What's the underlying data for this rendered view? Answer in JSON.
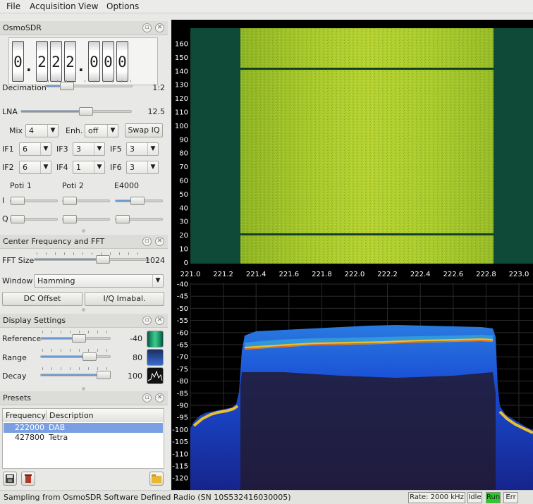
{
  "menu": [
    "File",
    "Acquisition",
    "View",
    "Options"
  ],
  "osmo": {
    "title": "OsmoSDR",
    "freq_digits": [
      "0",
      ".",
      "2",
      "2",
      "2",
      ".",
      "0",
      "0",
      "0"
    ],
    "decimation": {
      "label": "Decimation",
      "value": "1:2",
      "level": 0.25
    },
    "lna": {
      "label": "LNA",
      "value": "12.5",
      "level": 0.59
    },
    "mix": {
      "label": "Mix",
      "value": "4"
    },
    "enh": {
      "label": "Enh.",
      "value": "off"
    },
    "swap_iq": "Swap IQ",
    "if_stages": [
      {
        "label": "IF1",
        "value": "6"
      },
      {
        "label": "IF3",
        "value": "3"
      },
      {
        "label": "IF5",
        "value": "3"
      },
      {
        "label": "IF2",
        "value": "6"
      },
      {
        "label": "IF4",
        "value": "1"
      },
      {
        "label": "IF6",
        "value": "3"
      }
    ],
    "poti_labels": [
      "Poti 1",
      "Poti 2",
      "E4000"
    ],
    "row_i": "I",
    "row_q": "Q"
  },
  "center": {
    "title": "Center Frequency and FFT",
    "fft_size": {
      "label": "FFT Size",
      "value": "1024",
      "level": 0.6
    },
    "window": {
      "label": "Window",
      "value": "Hamming"
    },
    "dc_offset": "DC Offset",
    "iq_imbal": "I/Q Imabal."
  },
  "display": {
    "title": "Display Settings",
    "reference": {
      "label": "Reference",
      "value": "-40",
      "level": 0.55
    },
    "range": {
      "label": "Range",
      "value": "80",
      "level": 0.7
    },
    "decay": {
      "label": "Decay",
      "value": "100",
      "level": 0.98
    }
  },
  "presets": {
    "title": "Presets",
    "col_freq": "Frequency",
    "col_desc": "Description",
    "rows": [
      {
        "freq": "222000",
        "desc": "DAB",
        "selected": true
      },
      {
        "freq": "427800",
        "desc": "Tetra",
        "selected": false
      }
    ]
  },
  "waterfall": {
    "y_ticks": [
      "160",
      "150",
      "140",
      "130",
      "120",
      "110",
      "100",
      "90",
      "80",
      "70",
      "60",
      "50",
      "40",
      "30",
      "20",
      "10",
      "0"
    ],
    "x_ticks": [
      "221.0",
      "221.2",
      "221.4",
      "221.6",
      "221.8",
      "222.0",
      "222.2",
      "222.4",
      "222.6",
      "222.8",
      "223.0"
    ]
  },
  "spectrum": {
    "y_ticks": [
      "-40",
      "-45",
      "-50",
      "-55",
      "-60",
      "-65",
      "-70",
      "-75",
      "-80",
      "-85",
      "-90",
      "-95",
      "-100",
      "-105",
      "-110",
      "-115",
      "-120"
    ]
  },
  "status": {
    "text": "Sampling from OsmoSDR Software Defined Radio (SN  10S532416030005)",
    "rate": "Rate: 2000 kHz",
    "idle": "Idle",
    "run": "Run",
    "err": "Err"
  },
  "colors": {
    "run_green": "#22d022",
    "selection": "#7a9fe2",
    "signal_yellow": "#b8d030",
    "spectrum_blue": "#1c50d8"
  }
}
